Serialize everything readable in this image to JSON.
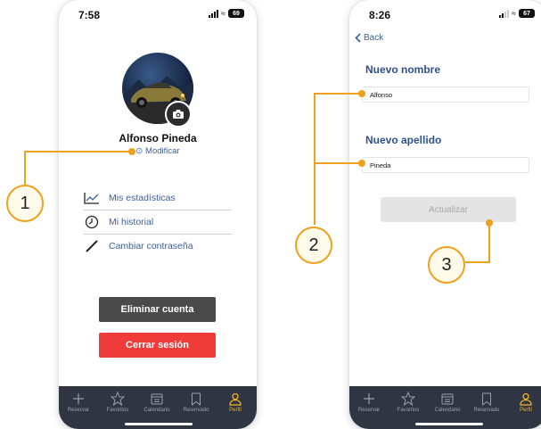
{
  "left_screen": {
    "status": {
      "time": "7:58",
      "battery": "69"
    },
    "profile": {
      "name": "Alfonso Pineda",
      "modify_label": "Modificar"
    },
    "menu": [
      {
        "label": "Mis estadísticas",
        "icon": "chart-icon"
      },
      {
        "label": "Mi historial",
        "icon": "clock-icon"
      },
      {
        "label": "Cambiar contraseña",
        "icon": "pencil-icon"
      }
    ],
    "buttons": {
      "delete_account": "Eliminar cuenta",
      "logout": "Cerrar sesión"
    }
  },
  "right_screen": {
    "status": {
      "time": "8:26",
      "battery": "67"
    },
    "back_label": "Back",
    "first_name": {
      "label": "Nuevo nombre",
      "value": "Alfonso"
    },
    "last_name": {
      "label": "Nuevo apellido",
      "value": "Pineda"
    },
    "update_button": "Actualizar"
  },
  "tabbar": {
    "items": [
      {
        "label": "Reservar",
        "icon": "plus-icon"
      },
      {
        "label": "Favoritos",
        "icon": "star-icon"
      },
      {
        "label": "Calendario",
        "icon": "calendar-icon"
      },
      {
        "label": "Reservado",
        "icon": "bookmark-icon"
      },
      {
        "label": "Perfil",
        "icon": "person-icon"
      }
    ],
    "active_index": 4
  },
  "callouts": [
    "1",
    "2",
    "3"
  ],
  "colors": {
    "accent": "#f0a01c",
    "link": "#3a5f9e",
    "tabbar": "#2f3542",
    "danger": "#f03b3b",
    "active_tab": "#f5b324"
  }
}
